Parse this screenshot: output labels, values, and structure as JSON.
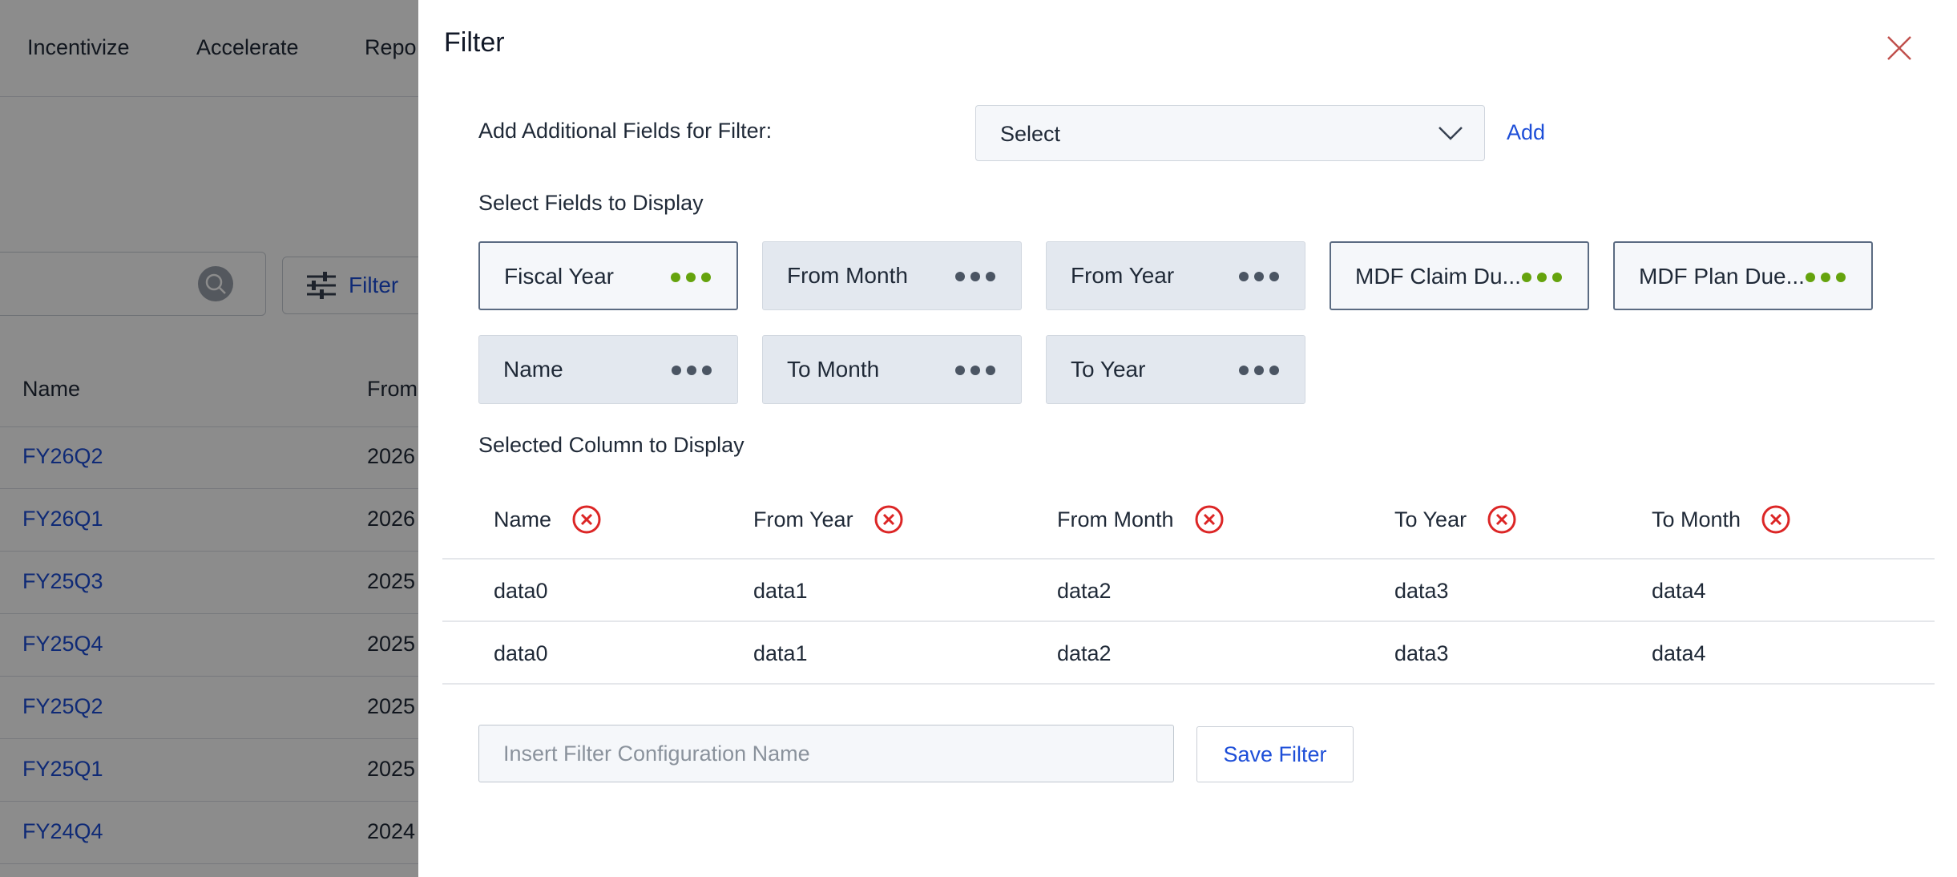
{
  "background": {
    "nav": [
      "Incentivize",
      "Accelerate",
      "Repo"
    ],
    "filter_button_label": "Filter",
    "table_headers": [
      "Name",
      "From"
    ],
    "rows": [
      {
        "name": "FY26Q2",
        "year": "2026"
      },
      {
        "name": "FY26Q1",
        "year": "2026"
      },
      {
        "name": "FY25Q3",
        "year": "2025"
      },
      {
        "name": "FY25Q4",
        "year": "2025"
      },
      {
        "name": "FY25Q2",
        "year": "2025"
      },
      {
        "name": "FY25Q1",
        "year": "2025"
      },
      {
        "name": "FY24Q4",
        "year": "2024"
      }
    ]
  },
  "panel": {
    "title": "Filter",
    "add_fields_label": "Add Additional Fields for Filter:",
    "select_value": "Select",
    "add_link": "Add",
    "fields_label": "Select Fields to Display",
    "fields": [
      {
        "label": "Fiscal Year",
        "selected": true
      },
      {
        "label": "From Month",
        "selected": false
      },
      {
        "label": "From Year",
        "selected": false
      },
      {
        "label": "MDF Claim Du...",
        "selected": true
      },
      {
        "label": "MDF Plan Due...",
        "selected": true
      },
      {
        "label": "Name",
        "selected": false
      },
      {
        "label": "To Month",
        "selected": false
      },
      {
        "label": "To Year",
        "selected": false
      }
    ],
    "selected_columns_label": "Selected Column to Display",
    "columns": [
      "Name",
      "From Year",
      "From Month",
      "To Year",
      "To Month"
    ],
    "rows": [
      [
        "data0",
        "data1",
        "data2",
        "data3",
        "data4"
      ],
      [
        "data0",
        "data1",
        "data2",
        "data3",
        "data4"
      ]
    ],
    "config_name_placeholder": "Insert Filter Configuration Name",
    "save_button": "Save Filter"
  },
  "colors": {
    "accent": "#1d4ed8",
    "selected_dots": "#65a30d",
    "remove_icon": "#dc2626"
  }
}
